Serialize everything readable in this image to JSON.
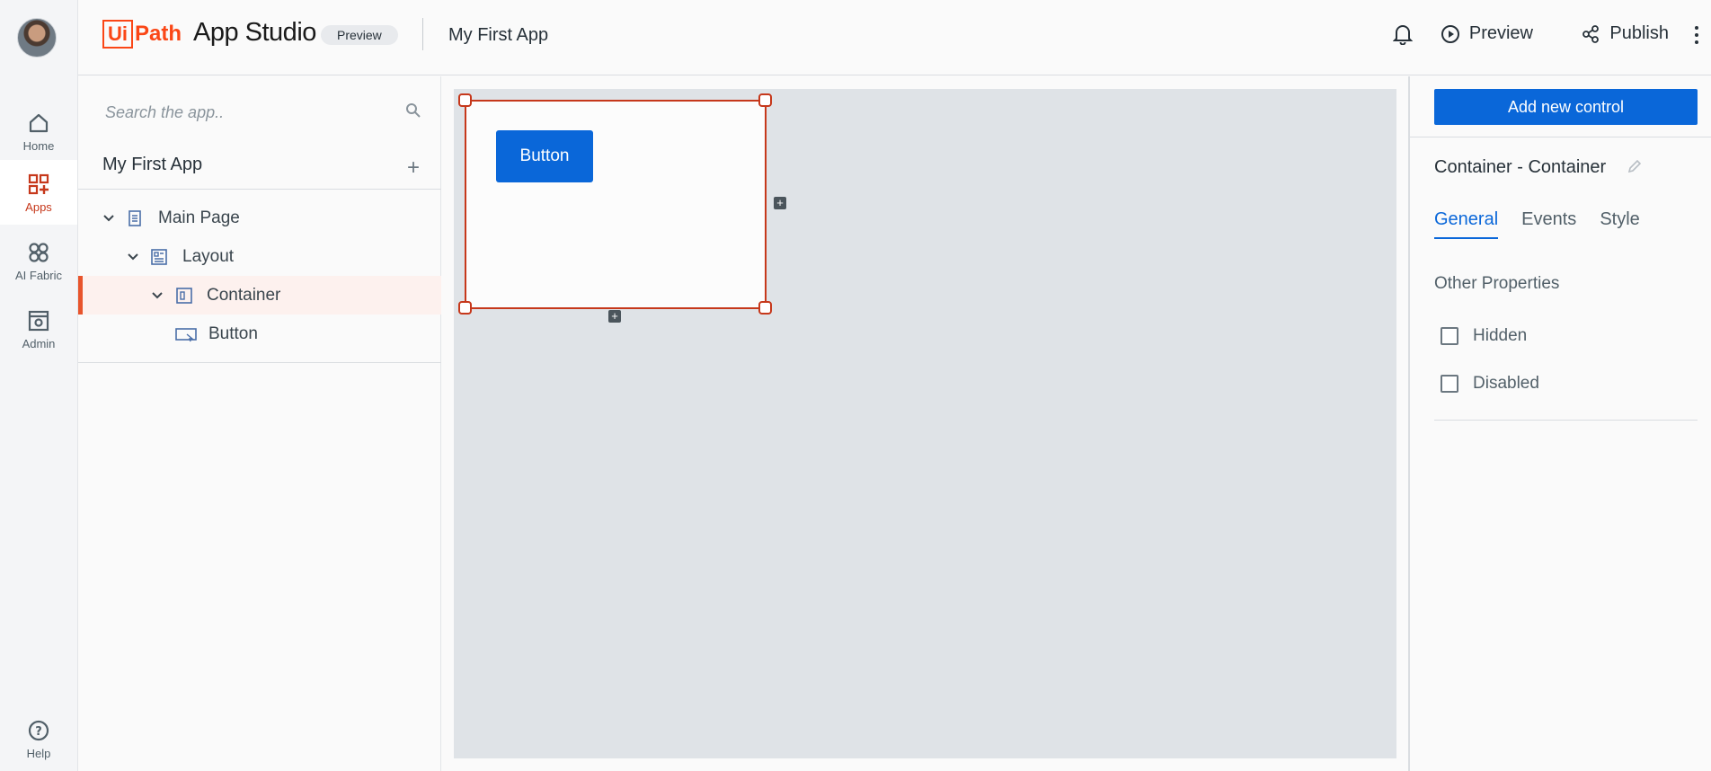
{
  "nav": {
    "items": [
      {
        "label": "Home",
        "icon": "home-icon"
      },
      {
        "label": "Apps",
        "icon": "apps-icon"
      },
      {
        "label": "AI Fabric",
        "icon": "ai-fabric-icon"
      },
      {
        "label": "Admin",
        "icon": "admin-icon"
      }
    ],
    "help_label": "Help"
  },
  "header": {
    "logo_ui": "Ui",
    "logo_path": "Path",
    "product": "App Studio",
    "badge": "Preview",
    "project": "My First App",
    "preview_label": "Preview",
    "publish_label": "Publish"
  },
  "explorer": {
    "search_placeholder": "Search the app..",
    "project_title": "My First App",
    "tree": [
      {
        "label": "Main Page",
        "expanded": true
      },
      {
        "label": "Layout",
        "expanded": true
      },
      {
        "label": "Container",
        "expanded": true,
        "selected": true
      },
      {
        "label": "Button"
      }
    ]
  },
  "canvas": {
    "button_label": "Button"
  },
  "props": {
    "add_control_label": "Add new control",
    "title": "Container - Container",
    "tabs": [
      "General",
      "Events",
      "Style"
    ],
    "active_tab": "General",
    "section_title": "Other Properties",
    "checkboxes": [
      {
        "label": "Hidden",
        "checked": false
      },
      {
        "label": "Disabled",
        "checked": false
      }
    ]
  },
  "colors": {
    "accent": "#fa4616",
    "primary_blue": "#0a67d9",
    "selection": "#c6381b",
    "canvas_bg": "#dfe3e7"
  }
}
